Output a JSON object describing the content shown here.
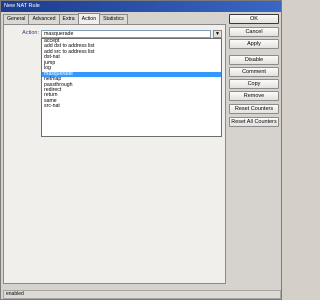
{
  "window": {
    "title": "New NAT Rule"
  },
  "tabs": [
    {
      "label": "General"
    },
    {
      "label": "Advanced"
    },
    {
      "label": "Extra"
    },
    {
      "label": "Action"
    },
    {
      "label": "Statistics"
    }
  ],
  "active_tab": "Action",
  "form": {
    "action_label": "Action:",
    "action_value": "masquerade",
    "action_options": [
      "accept",
      "add dst to address list",
      "add src to address list",
      "dst-nat",
      "jump",
      "log",
      "masquerade",
      "netmap",
      "passthrough",
      "redirect",
      "return",
      "same",
      "src-nat"
    ],
    "selected_option": "masquerade"
  },
  "buttons": {
    "ok": "OK",
    "cancel": "Cancel",
    "apply": "Apply",
    "disable": "Disable",
    "comment": "Comment",
    "copy": "Copy",
    "remove": "Remove",
    "reset_counters": "Reset Counters",
    "reset_all_counters": "Reset All Counters"
  },
  "status": {
    "text": "enabled"
  },
  "icons": {
    "combo_arrow": "chevron-down-icon"
  },
  "colors": {
    "title_bar": "#1c3c8c",
    "selection": "#3399ff",
    "label_text": "#3b3b7a"
  }
}
